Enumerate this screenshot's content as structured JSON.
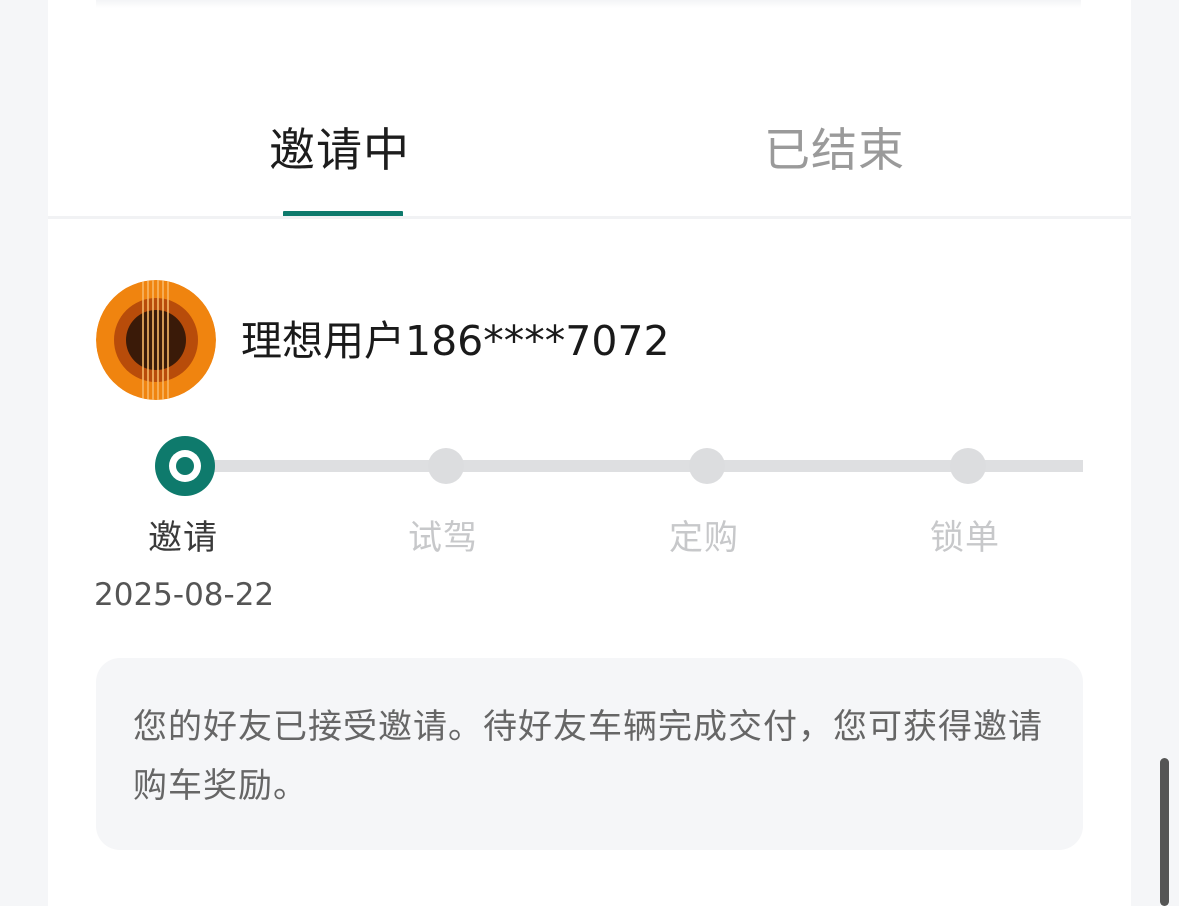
{
  "tabs": {
    "active_label": "邀请中",
    "inactive_label": "已结束"
  },
  "invitee": {
    "name": "理想用户186****7072"
  },
  "progress": {
    "steps": [
      {
        "label": "邀请",
        "status": "done"
      },
      {
        "label": "试驾",
        "status": "pending"
      },
      {
        "label": "定购",
        "status": "pending"
      },
      {
        "label": "锁单",
        "status": "pending"
      }
    ],
    "completed_date": "2025-08-22"
  },
  "notice": {
    "text": "您的好友已接受邀请。待好友车辆完成交付，您可获得邀请购车奖励。"
  },
  "colors": {
    "accent": "#0e7a6c",
    "inactive_dot": "#dcdddf",
    "track": "#dedfe1",
    "avatar_orange": "#f0840f"
  }
}
